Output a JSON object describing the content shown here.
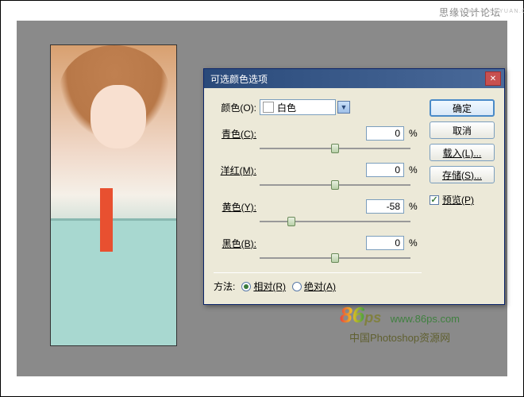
{
  "watermark": {
    "top": "思缘设计论坛",
    "top_url": "WWW.MISSYUAN.COM",
    "logo_num": "86",
    "logo_ps": "ps",
    "url": "www.86ps.com",
    "sub": "中国Photoshop资源网"
  },
  "dialog": {
    "title": "可选颜色选项",
    "color_label": "颜色(O):",
    "color_value": "白色",
    "sliders": {
      "cyan": {
        "label": "青色(C):",
        "value": "0",
        "pos": 50
      },
      "magenta": {
        "label": "洋红(M):",
        "value": "0",
        "pos": 50
      },
      "yellow": {
        "label": "黄色(Y):",
        "value": "-58",
        "pos": 21
      },
      "black": {
        "label": "黑色(B):",
        "value": "0",
        "pos": 50
      }
    },
    "percent": "%",
    "method_label": "方法:",
    "relative": "相对(R)",
    "absolute": "绝对(A)",
    "buttons": {
      "ok": "确定",
      "cancel": "取消",
      "load": "载入(L)...",
      "save": "存储(S)..."
    },
    "preview": "预览(P)"
  }
}
